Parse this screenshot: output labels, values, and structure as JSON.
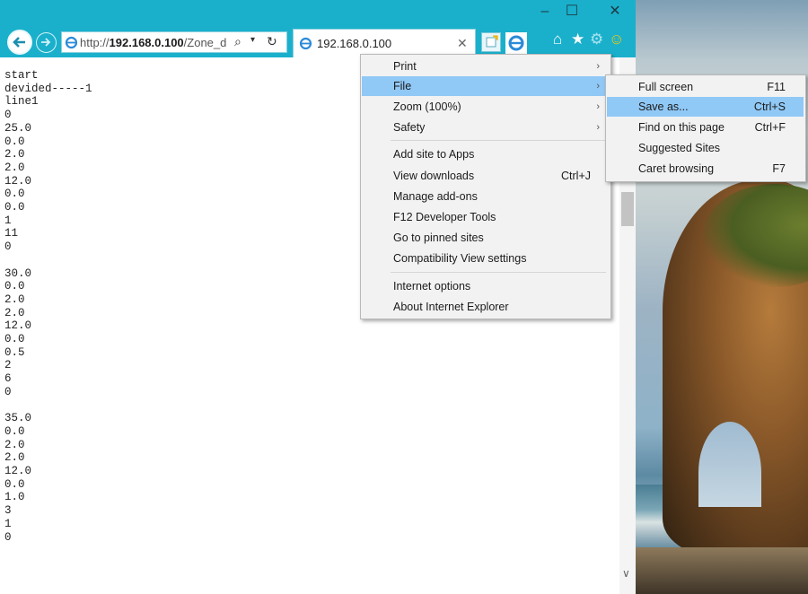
{
  "browser": {
    "url_prefix": "http://",
    "url_host": "192.168.0.100",
    "url_path": "/Zone_d",
    "tab_title": "192.168.0.100"
  },
  "content": {
    "lines": [
      "start",
      "devided-----1",
      "line1",
      "0",
      "25.0",
      "0.0",
      "2.0",
      "2.0",
      "12.0",
      "0.0",
      "0.0",
      "1",
      "11",
      "0",
      "",
      "30.0",
      "0.0",
      "2.0",
      "2.0",
      "12.0",
      "0.0",
      "0.5",
      "2",
      "6",
      "0",
      "",
      "35.0",
      "0.0",
      "2.0",
      "2.0",
      "12.0",
      "0.0",
      "1.0",
      "3",
      "1",
      "0"
    ]
  },
  "tools_menu": {
    "items": [
      {
        "label": "Print",
        "submenu": true
      },
      {
        "label": "File",
        "submenu": true,
        "highlighted": true
      },
      {
        "label": "Zoom (100%)",
        "submenu": true
      },
      {
        "label": "Safety",
        "submenu": true
      },
      {
        "label": "Add site to Apps"
      },
      {
        "label": "View downloads",
        "shortcut": "Ctrl+J"
      },
      {
        "label": "Manage add-ons"
      },
      {
        "label": "F12 Developer Tools"
      },
      {
        "label": "Go to pinned sites"
      },
      {
        "label": "Compatibility View settings"
      },
      {
        "label": "Internet options"
      },
      {
        "label": "About Internet Explorer"
      }
    ]
  },
  "file_menu": {
    "items": [
      {
        "label": "Full screen",
        "shortcut": "F11"
      },
      {
        "label": "Save as...",
        "shortcut": "Ctrl+S",
        "highlighted": true
      },
      {
        "label": "Find on this page",
        "shortcut": "Ctrl+F"
      },
      {
        "label": "Suggested Sites"
      },
      {
        "label": "Caret browsing",
        "shortcut": "F7"
      }
    ]
  },
  "colors": {
    "chrome": "#1ab0cc",
    "menu_highlight": "#90c8f6",
    "menu_background": "#f2f2f2"
  },
  "icons": [
    "back-icon",
    "forward-icon",
    "ie-logo-icon",
    "search-icon",
    "dropdown-icon",
    "refresh-icon",
    "close-tab-icon",
    "new-tab-icon",
    "home-icon",
    "favorites-star-icon",
    "tools-gear-icon",
    "smiley-feedback-icon",
    "minimize-icon",
    "maximize-icon",
    "close-window-icon",
    "scroll-down-icon",
    "submenu-arrow-icon"
  ]
}
